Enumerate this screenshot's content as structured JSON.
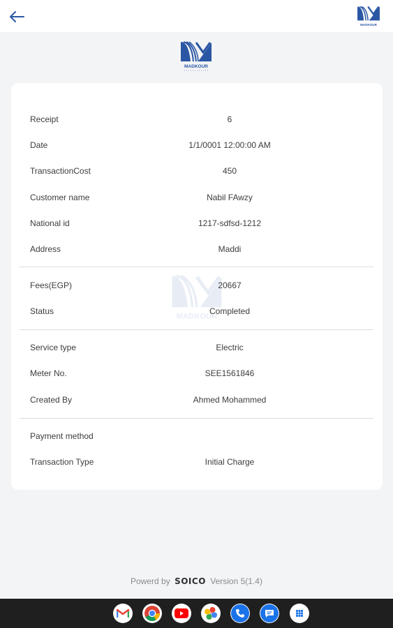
{
  "header": {
    "back_icon": "arrow-left-icon",
    "logo_text": "MADKOUR"
  },
  "brand_logo": {
    "text": "MADKOUR"
  },
  "receipt": {
    "rows": [
      {
        "label": "Receipt",
        "value": "6"
      },
      {
        "label": "Date",
        "value": "1/1/0001 12:00:00 AM"
      },
      {
        "label": "TransactionCost",
        "value": "450"
      },
      {
        "label": "Customer name",
        "value": "Nabil FAwzy"
      },
      {
        "label": "National id",
        "value": "1217-sdfsd-1212"
      },
      {
        "label": "Address",
        "value": "Maddi"
      },
      {
        "label": "Fees(EGP)",
        "value": "20667"
      },
      {
        "label": "Status",
        "value": "Completed"
      },
      {
        "label": "Service type",
        "value": "Electric"
      },
      {
        "label": "Meter No.",
        "value": "SEE1561846"
      },
      {
        "label": "Created By",
        "value": "Ahmed Mohammed"
      },
      {
        "label": "Payment method",
        "value": ""
      },
      {
        "label": "Transaction Type",
        "value": "Initial Charge"
      }
    ]
  },
  "footer": {
    "prefix": "Powerd by",
    "brand": "SOICO",
    "version": "Version 5(1.4)"
  },
  "taskbar": {
    "apps": [
      "gmail-icon",
      "chrome-icon",
      "youtube-icon",
      "photos-icon",
      "phone-icon",
      "messages-icon",
      "app-drawer-icon"
    ]
  },
  "colors": {
    "accent": "#2a56a4",
    "card": "#ffffff",
    "background": "#f3f4f6",
    "taskbar": "#1f1f1f"
  }
}
